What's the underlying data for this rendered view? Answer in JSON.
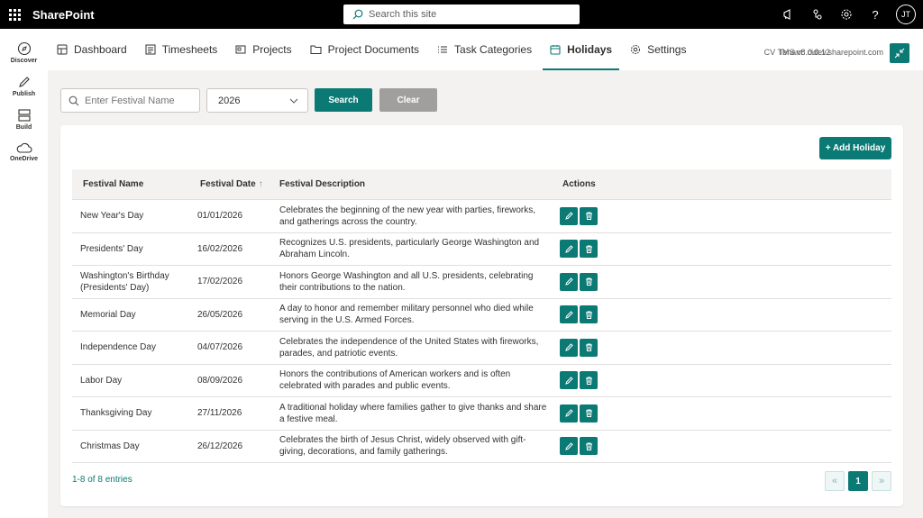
{
  "app": {
    "brand": "SharePoint"
  },
  "topbar": {
    "search_placeholder": "Search this site",
    "icons": [
      "megaphone-icon",
      "share-icon",
      "gear-icon",
      "help-icon"
    ],
    "help_glyph": "?",
    "avatar_initials": "JT"
  },
  "rail": {
    "items": [
      {
        "label": "Discover",
        "icon": "compass-icon"
      },
      {
        "label": "Publish",
        "icon": "pen-icon"
      },
      {
        "label": "Build",
        "icon": "layout-icon"
      },
      {
        "label": "OneDrive",
        "icon": "cloud-icon"
      }
    ]
  },
  "nav": {
    "tabs": [
      {
        "label": "Dashboard",
        "icon": "dashboard-icon"
      },
      {
        "label": "Timesheets",
        "icon": "timesheet-icon"
      },
      {
        "label": "Projects",
        "icon": "projects-icon"
      },
      {
        "label": "Project Documents",
        "icon": "folder-icon"
      },
      {
        "label": "Task Categories",
        "icon": "list-icon"
      },
      {
        "label": "Holidays",
        "icon": "calendar-icon",
        "active": true
      },
      {
        "label": "Settings",
        "icon": "gear-icon"
      }
    ],
    "version": "CV TMS v8.0.0.12",
    "tenant": "Tenant: cidev.sharepoint.com"
  },
  "filters": {
    "festival_placeholder": "Enter Festival Name",
    "festival_value": "",
    "year_value": "2026",
    "search_label": "Search",
    "clear_label": "Clear"
  },
  "card": {
    "add_label": "+ Add Holiday",
    "columns": {
      "name": "Festival Name",
      "date": "Festival Date",
      "date_sort": "↑",
      "desc": "Festival Description",
      "actions": "Actions"
    },
    "rows": [
      {
        "name": "New Year's Day",
        "date": "01/01/2026",
        "desc": "Celebrates the beginning of the new year with parties, fireworks, and gatherings across the country."
      },
      {
        "name": "Presidents' Day",
        "date": "16/02/2026",
        "desc": "Recognizes U.S. presidents, particularly George Washington and Abraham Lincoln."
      },
      {
        "name": "Washington's Birthday (Presidents' Day)",
        "date": "17/02/2026",
        "desc": "Honors George Washington and all U.S. presidents, celebrating their contributions to the nation."
      },
      {
        "name": "Memorial Day",
        "date": "26/05/2026",
        "desc": "A day to honor and remember military personnel who died while serving in the U.S. Armed Forces."
      },
      {
        "name": "Independence Day",
        "date": "04/07/2026",
        "desc": "Celebrates the independence of the United States with fireworks, parades, and patriotic events."
      },
      {
        "name": "Labor Day",
        "date": "08/09/2026",
        "desc": "Honors the contributions of American workers and is often celebrated with parades and public events."
      },
      {
        "name": "Thanksgiving Day",
        "date": "27/11/2026",
        "desc": "A traditional holiday where families gather to give thanks and share a festive meal."
      },
      {
        "name": "Christmas Day",
        "date": "26/12/2026",
        "desc": "Celebrates the birth of Jesus Christ, widely observed with gift-giving, decorations, and family gatherings."
      }
    ],
    "entries_text": "1-8 of 8 entries",
    "pager": {
      "prev": "«",
      "page": "1",
      "next": "»"
    }
  },
  "colors": {
    "accent": "#0b7a75",
    "topbar": "#000000",
    "clear_button": "#a19f9d"
  }
}
